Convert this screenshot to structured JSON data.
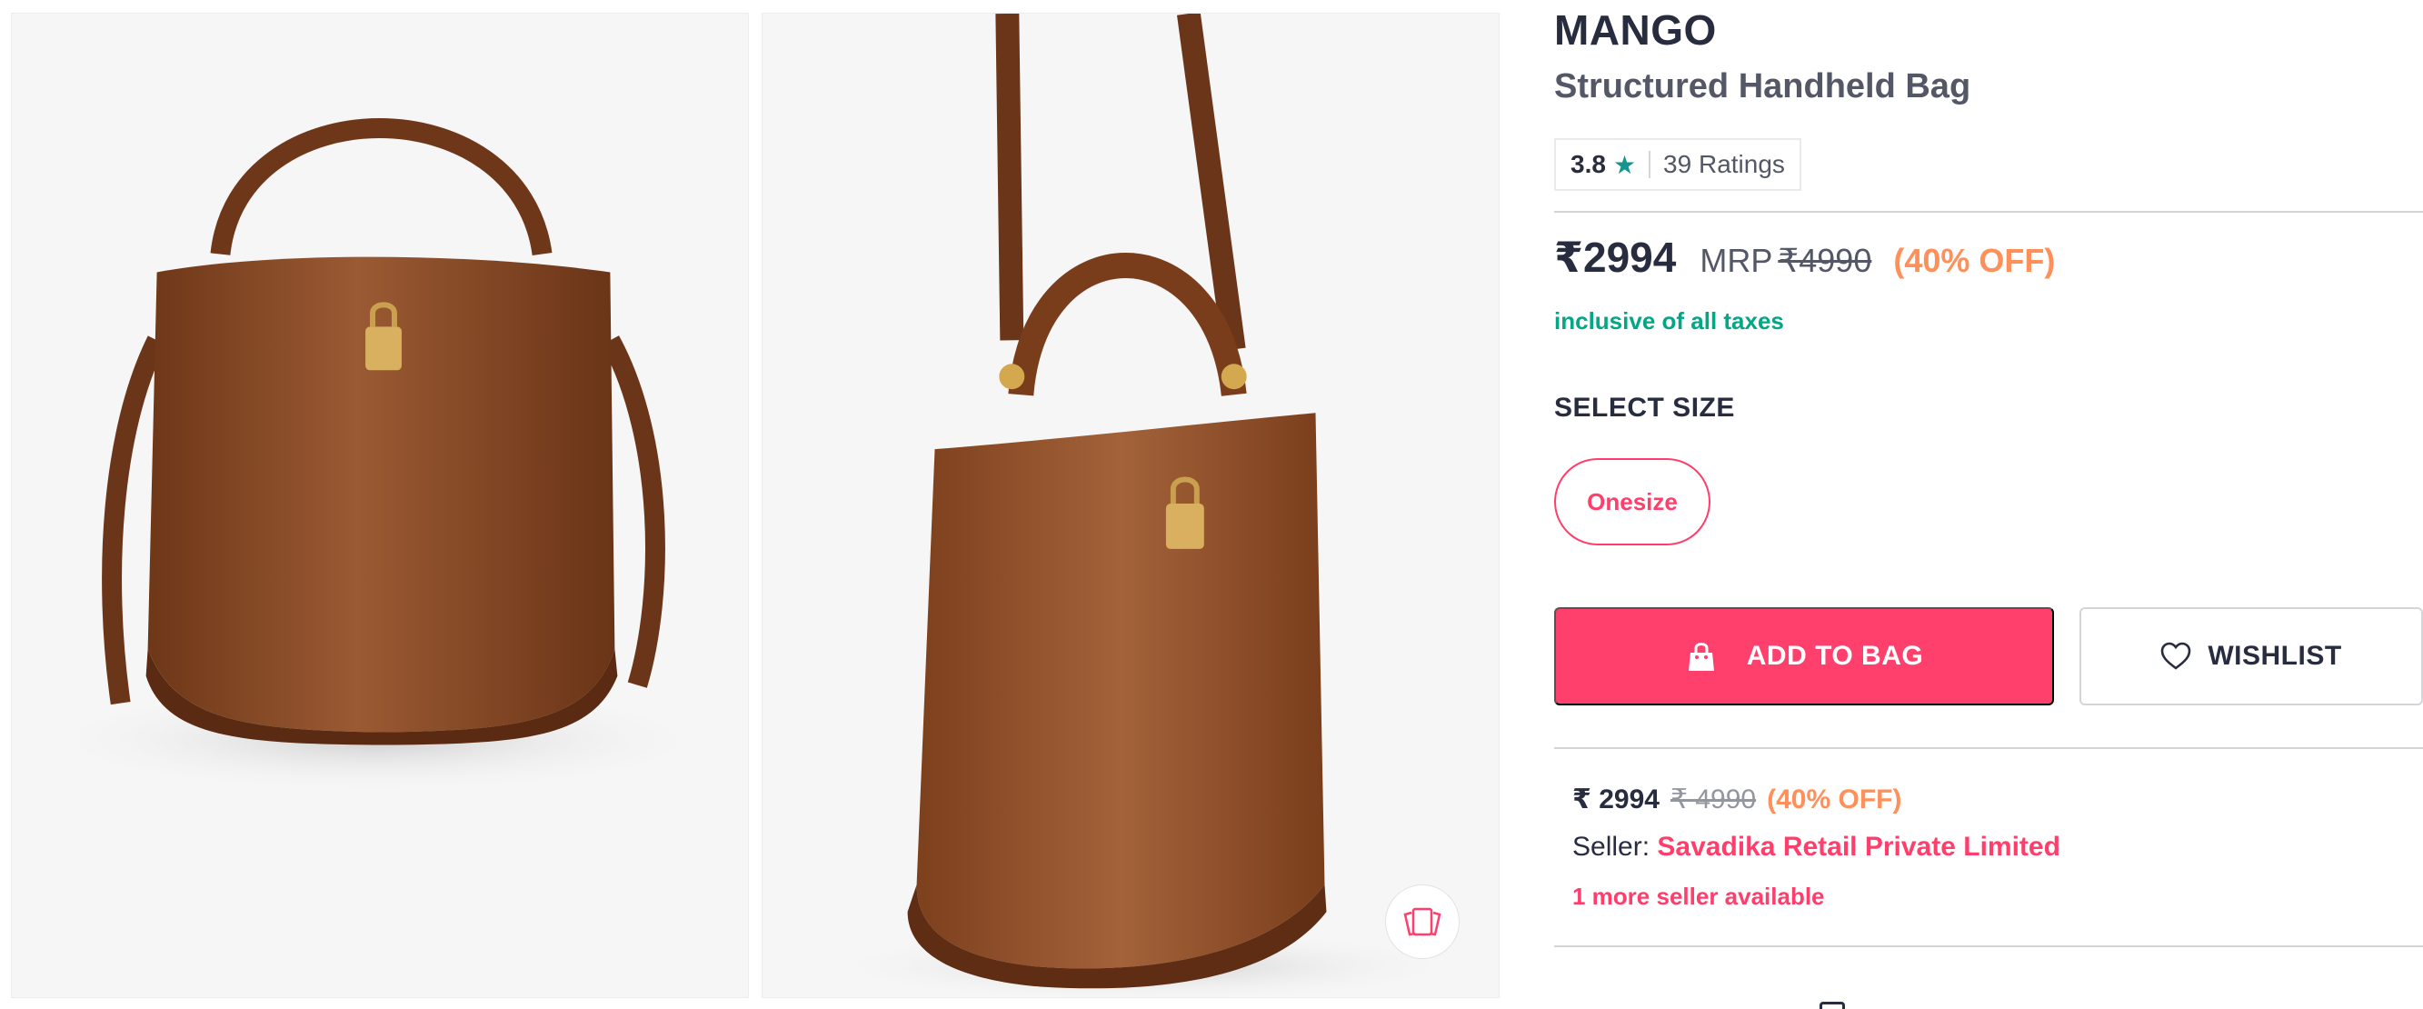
{
  "gallery": {
    "images": [
      {
        "alt": "Brown structured bucket handbag, front view"
      },
      {
        "alt": "Brown structured bucket handbag, side view with shoulder strap"
      }
    ],
    "similar_icon": "view-similar-icon"
  },
  "product": {
    "brand": "MANGO",
    "name": "Structured Handheld Bag",
    "rating": {
      "value": "3.8",
      "star": "★",
      "count_label": "39 Ratings"
    },
    "price": {
      "selling": "₹2994",
      "mrp_label": "MRP",
      "mrp": "₹4990",
      "discount": "(40% OFF)",
      "tax_note": "inclusive of all taxes"
    },
    "size": {
      "heading": "SELECT SIZE",
      "options": [
        "Onesize"
      ]
    },
    "actions": {
      "add_to_bag": "ADD TO BAG",
      "wishlist": "WISHLIST"
    },
    "seller": {
      "price": "₹ 2994",
      "mrp": "₹ 4990",
      "discount": "(40% OFF)",
      "label": "Seller:",
      "name": "Savadika Retail Private Limited",
      "more": "1 more seller available"
    }
  },
  "colors": {
    "accent": "#ff3f6c",
    "discount": "#ff905a",
    "tax": "#03a685",
    "rating_star": "#14958f",
    "bag_leather": "#8a4a24"
  }
}
